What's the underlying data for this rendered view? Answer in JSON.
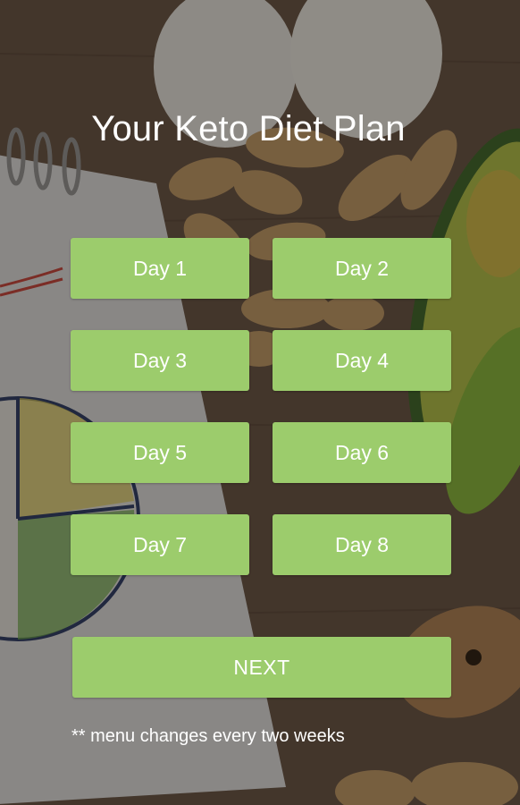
{
  "screen": {
    "title": "Your Keto Diet Plan"
  },
  "days": [
    {
      "label": "Day 1"
    },
    {
      "label": "Day 2"
    },
    {
      "label": "Day 3"
    },
    {
      "label": "Day 4"
    },
    {
      "label": "Day 5"
    },
    {
      "label": "Day 6"
    },
    {
      "label": "Day 7"
    },
    {
      "label": "Day 8"
    }
  ],
  "actions": {
    "next_label": "NEXT"
  },
  "footnote": "** menu changes every two weeks",
  "colors": {
    "button_green": "#9ccc6c",
    "text": "#ffffff"
  }
}
